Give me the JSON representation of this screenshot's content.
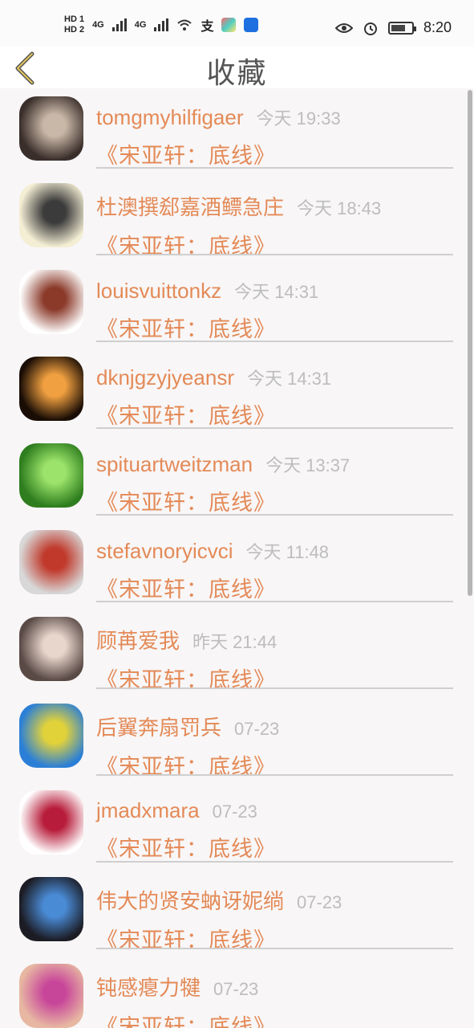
{
  "status_bar": {
    "hd1": "HD 1",
    "hd2": "HD 2",
    "net1": "4G",
    "net2": "4G",
    "time": "8:20"
  },
  "header": {
    "title": "收藏",
    "back_icon": "chevron-left-icon"
  },
  "items": [
    {
      "name": "tomgmyhilfigaer",
      "time": "今天 19:33",
      "book": "《宋亚轩：底线》",
      "avatar_colors": [
        "#3a2e2a",
        "#c9b8a8"
      ]
    },
    {
      "name": "杜澳撰郄嘉酒鳔急庄",
      "time": "今天 18:43",
      "book": "《宋亚轩：底线》",
      "avatar_colors": [
        "#f4eed4",
        "#3b3b3b"
      ]
    },
    {
      "name": "louisvuittonkz",
      "time": "今天 14:31",
      "book": "《宋亚轩：底线》",
      "avatar_colors": [
        "#ffffff",
        "#8b3a2a"
      ]
    },
    {
      "name": "dknjgzyjyeansr",
      "time": "今天 14:31",
      "book": "《宋亚轩：底线》",
      "avatar_colors": [
        "#1a0d05",
        "#f0a040"
      ]
    },
    {
      "name": "spituartweitzman",
      "time": "今天 13:37",
      "book": "《宋亚轩：底线》",
      "avatar_colors": [
        "#2e7d1e",
        "#9be36a"
      ]
    },
    {
      "name": "stefavnoryicvci",
      "time": "今天 11:48",
      "book": "《宋亚轩：底线》",
      "avatar_colors": [
        "#d8d8d8",
        "#c0392b"
      ]
    },
    {
      "name": "顾苒爱我",
      "time": "昨天 21:44",
      "book": "《宋亚轩：底线》",
      "avatar_colors": [
        "#5a4a46",
        "#e8d6cc"
      ]
    },
    {
      "name": "后翼奔扇罚兵",
      "time": "07-23",
      "book": "《宋亚轩：底线》",
      "avatar_colors": [
        "#2b7fd6",
        "#e2d23a"
      ]
    },
    {
      "name": "jmadxmara",
      "time": "07-23",
      "book": "《宋亚轩：底线》",
      "avatar_colors": [
        "#ffffff",
        "#b71c3a"
      ]
    },
    {
      "name": "伟大的贤安蚋讶妮绱",
      "time": "07-23",
      "book": "《宋亚轩：底线》",
      "avatar_colors": [
        "#1c1c24",
        "#4a8bd6"
      ]
    },
    {
      "name": "钝感瘪力犍",
      "time": "07-23",
      "book": "《宋亚轩：底线》",
      "avatar_colors": [
        "#e7b7a2",
        "#c8469a"
      ]
    }
  ],
  "colors": {
    "accent": "#e48a57",
    "time_gray": "#bdbdbd",
    "background": "#f8f6f7"
  }
}
